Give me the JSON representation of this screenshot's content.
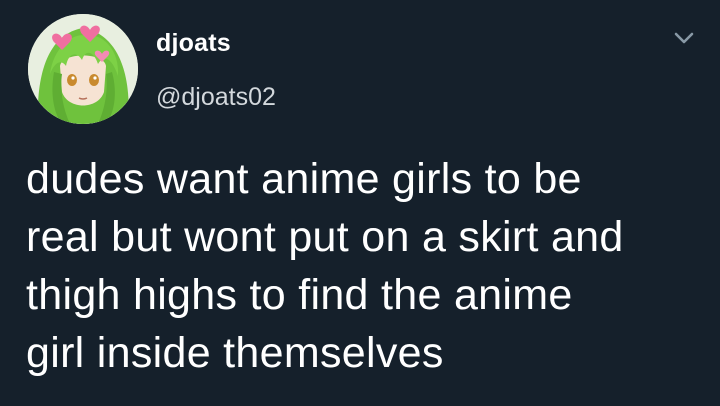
{
  "tweet": {
    "author": {
      "display_name": "djoats",
      "handle": "@djoats02",
      "avatar_icon": "anime-avatar-icon"
    },
    "menu_icon": "chevron-down-icon",
    "text": "dudes want anime girls to be\nreal but wont put on a skirt and\nthigh highs to find the anime\ngirl inside themselves"
  },
  "colors": {
    "background": "#15202b",
    "primary_text": "#ffffff",
    "secondary_text": "#d3d8dc",
    "icon": "#8899a6"
  }
}
